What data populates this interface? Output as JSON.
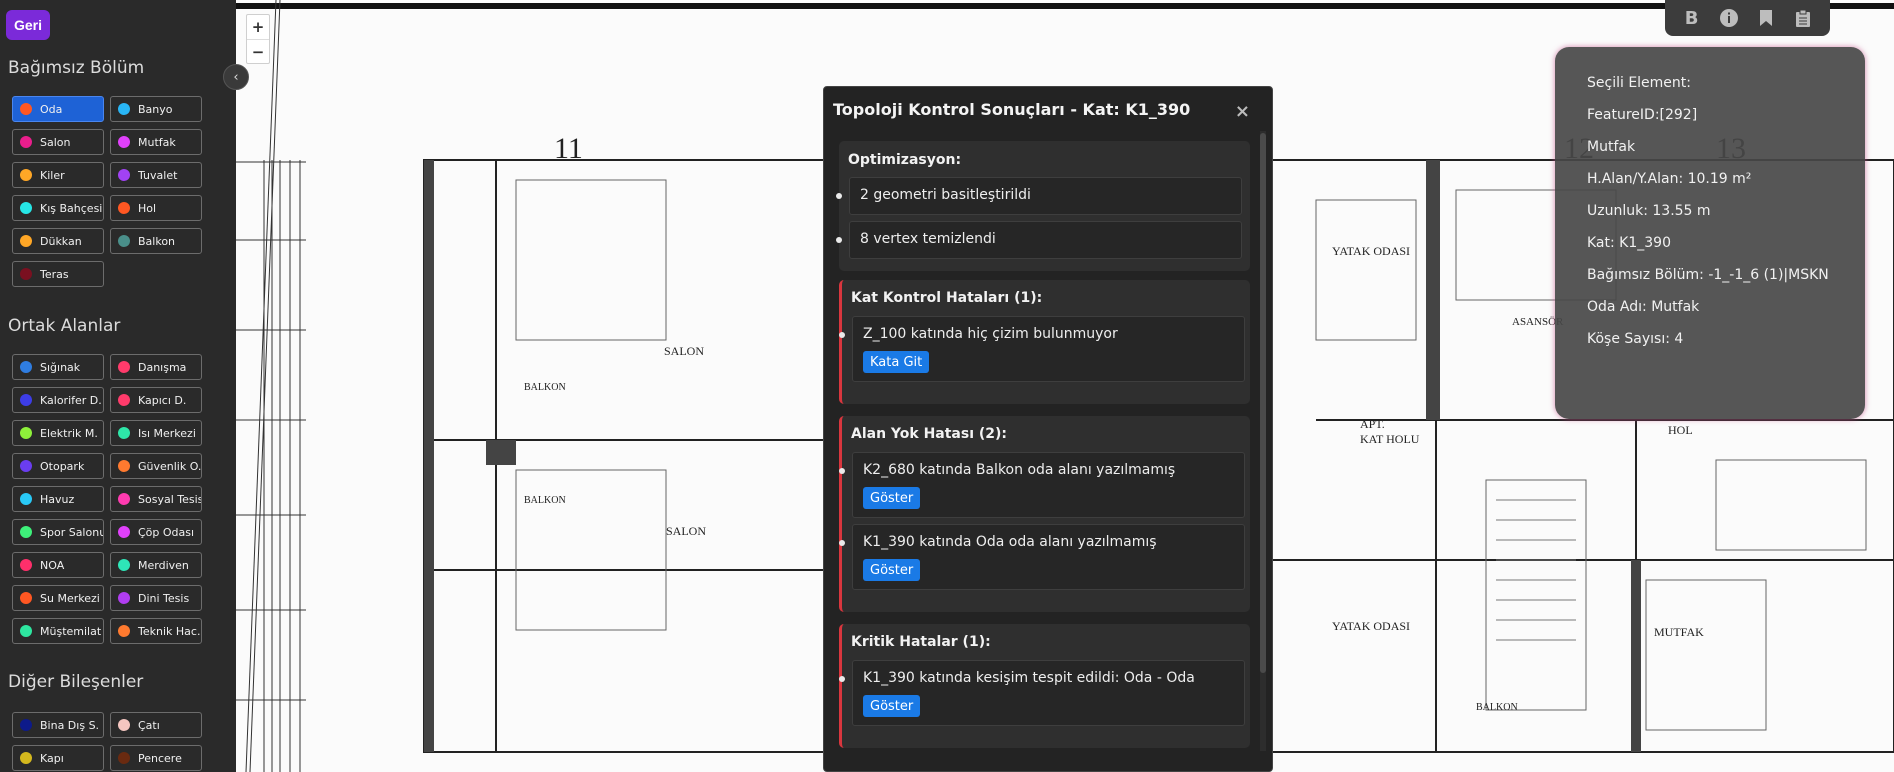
{
  "sidebar": {
    "back_label": "Geri",
    "collapse_icon": "chevron-left-icon",
    "sections": {
      "independent": {
        "title": "Bağımsız Bölüm",
        "items": [
          {
            "label": "Oda",
            "color": "#ff5722",
            "active": true
          },
          {
            "label": "Banyo",
            "color": "#29b6f6"
          },
          {
            "label": "Salon",
            "color": "#e91e8c"
          },
          {
            "label": "Mutfak",
            "color": "#e040fb"
          },
          {
            "label": "Kiler",
            "color": "#ffa726"
          },
          {
            "label": "Tuvalet",
            "color": "#a142f4"
          },
          {
            "label": "Kış Bahçesi",
            "color": "#26e6e6"
          },
          {
            "label": "Hol",
            "color": "#ff5722"
          },
          {
            "label": "Dükkan",
            "color": "#ffa726"
          },
          {
            "label": "Balkon",
            "color": "#4a8f8a"
          },
          {
            "label": "Teras",
            "color": "#7a1020"
          }
        ]
      },
      "common": {
        "title": "Ortak Alanlar",
        "items": [
          {
            "label": "Sığınak",
            "color": "#2f7de1"
          },
          {
            "label": "Danışma",
            "color": "#ff3b6b"
          },
          {
            "label": "Kalorifer D.",
            "color": "#3d3de6"
          },
          {
            "label": "Kapıcı D.",
            "color": "#ff3b6b"
          },
          {
            "label": "Elektrik M.",
            "color": "#8ef03a"
          },
          {
            "label": "Isı Merkezi",
            "color": "#2ee6a8"
          },
          {
            "label": "Otopark",
            "color": "#6a3df0"
          },
          {
            "label": "Güvenlik O.",
            "color": "#ff7a2f"
          },
          {
            "label": "Havuz",
            "color": "#29c9f6"
          },
          {
            "label": "Sosyal Tesis",
            "color": "#ff3bb0"
          },
          {
            "label": "Spor Salonu",
            "color": "#3ef07a"
          },
          {
            "label": "Çöp Odası",
            "color": "#e040fb"
          },
          {
            "label": "NOA",
            "color": "#ff2f6b"
          },
          {
            "label": "Merdiven",
            "color": "#2ee6b8"
          },
          {
            "label": "Su Merkezi",
            "color": "#ff5722"
          },
          {
            "label": "Dini Tesis",
            "color": "#b03df0"
          },
          {
            "label": "Müştemilat",
            "color": "#2ee6a0"
          },
          {
            "label": "Teknik Hac.",
            "color": "#ff7a2f"
          }
        ]
      },
      "other": {
        "title": "Diğer Bileşenler",
        "items": [
          {
            "label": "Bina Dış S.",
            "color": "#0d1a8a"
          },
          {
            "label": "Çatı",
            "color": "#f5c6c0"
          },
          {
            "label": "Kapı",
            "color": "#d4b81e"
          },
          {
            "label": "Pencere",
            "color": "#6a2a10"
          }
        ]
      }
    }
  },
  "map": {
    "zoom_in": "+",
    "zoom_out": "−",
    "plan_labels": {
      "axis_11": "11",
      "axis_12": "12",
      "axis_13": "13",
      "yatak_odasi": "YATAK ODASI",
      "salon_1": "SALON",
      "salon_2": "SALON",
      "apt_kat_holu_1": "APT.",
      "apt_kat_holu_2": "KAT HOLU",
      "asansor": "ASANSÖR",
      "hol": "HOL",
      "mutfak": "MUTFAK",
      "balkon_left_1": "BALKON",
      "balkon_left_2": "BALKON",
      "balkon_bottom": "BALKON",
      "yatak_odasi_2": "YATAK ODASI"
    }
  },
  "toolbar": {
    "b_label": "B",
    "icons": [
      "info-icon",
      "bookmark-icon",
      "clipboard-icon"
    ]
  },
  "info_panel": {
    "title": "Seçili Element:",
    "feature_id": "FeatureID:[292]",
    "type": "Mutfak",
    "area": "H.Alan/Y.Alan: 10.19 m²",
    "length": "Uzunluk: 13.55 m",
    "floor": "Kat: K1_390",
    "unit": "Bağımsız Bölüm: -1_-1_6 (1)|MSKN",
    "room_name": "Oda Adı: Mutfak",
    "corners": "Köşe Sayısı: 4"
  },
  "modal": {
    "title": "Topoloji Kontrol Sonuçları - Kat: K1_390",
    "close": "×",
    "optimization": {
      "title": "Optimizasyon:",
      "items": [
        "2 geometri basitleştirildi",
        "8 vertex temizlendi"
      ]
    },
    "floor_errors": {
      "title": "Kat Kontrol Hataları (1):",
      "items": [
        {
          "text": "Z_100 katında hiç çizim bulunmuyor",
          "button": "Kata Git"
        }
      ]
    },
    "area_errors": {
      "title": "Alan Yok Hatası (2):",
      "items": [
        {
          "text": "K2_680 katında Balkon oda alanı yazılmamış",
          "button": "Göster"
        },
        {
          "text": "K1_390 katında Oda oda alanı yazılmamış",
          "button": "Göster"
        }
      ]
    },
    "critical_errors": {
      "title": "Kritik Hatalar (1):",
      "items": [
        {
          "text": "K1_390 katında kesişim tespit edildi: Oda - Oda",
          "button": "Göster"
        }
      ]
    }
  }
}
